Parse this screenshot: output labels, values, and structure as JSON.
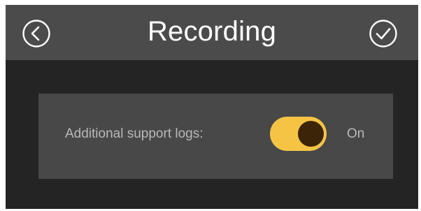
{
  "header": {
    "title": "Recording",
    "back_icon": "back-arrow-circle-icon",
    "confirm_icon": "checkmark-circle-icon"
  },
  "setting": {
    "label": "Additional support logs:",
    "enabled": true,
    "state_label": "On"
  },
  "colors": {
    "header_bg": "#4b4b4b",
    "page_bg": "#242424",
    "panel_bg": "#484848",
    "toggle_on": "#f6c445",
    "toggle_knob": "#3b2408",
    "text_muted": "#b9b9b9"
  }
}
